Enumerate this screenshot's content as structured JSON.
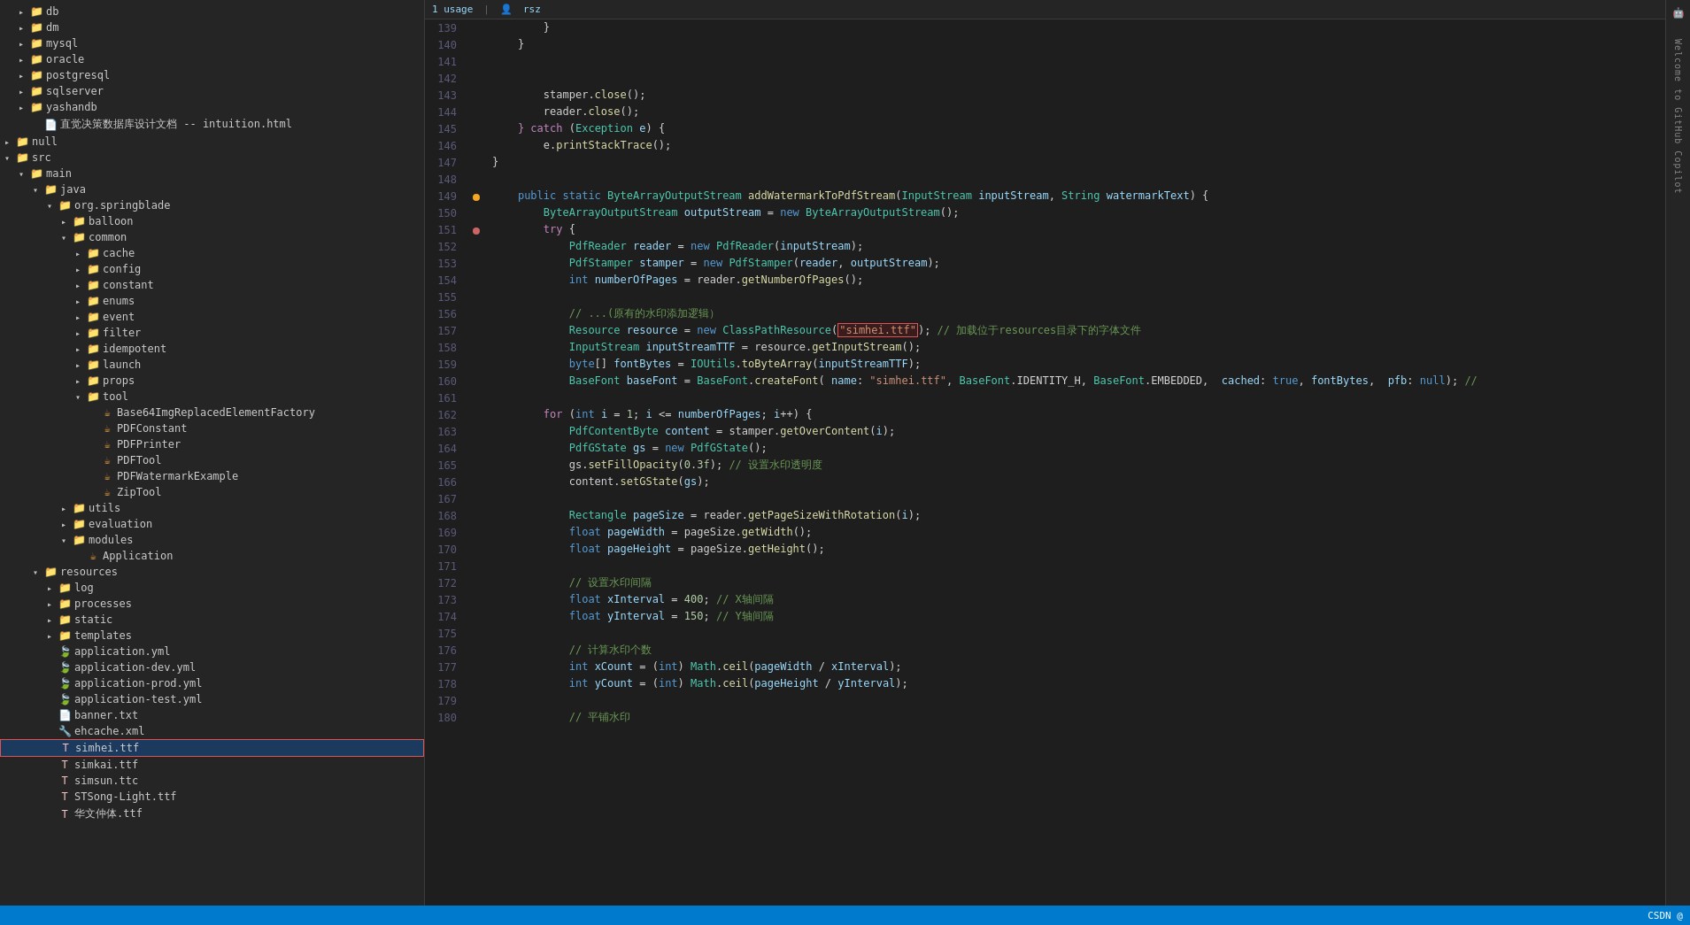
{
  "sidebar": {
    "items": [
      {
        "id": "db",
        "label": "db",
        "type": "folder",
        "indent": 1,
        "expanded": false
      },
      {
        "id": "dm",
        "label": "dm",
        "type": "folder",
        "indent": 1,
        "expanded": false
      },
      {
        "id": "mysql",
        "label": "mysql",
        "type": "folder",
        "indent": 1,
        "expanded": false
      },
      {
        "id": "oracle",
        "label": "oracle",
        "type": "folder",
        "indent": 1,
        "expanded": false
      },
      {
        "id": "postgresql",
        "label": "postgresql",
        "type": "folder",
        "indent": 1,
        "expanded": false
      },
      {
        "id": "sqlserver",
        "label": "sqlserver",
        "type": "folder",
        "indent": 1,
        "expanded": false
      },
      {
        "id": "yashandb",
        "label": "yashandb",
        "type": "folder",
        "indent": 1,
        "expanded": false
      },
      {
        "id": "intuition",
        "label": "直觉决策数据库设计文档 -- intuition.html",
        "type": "file",
        "indent": 2,
        "expanded": false
      },
      {
        "id": "null",
        "label": "null",
        "type": "folder",
        "indent": 0,
        "expanded": false
      },
      {
        "id": "src",
        "label": "src",
        "type": "folder",
        "indent": 0,
        "expanded": true
      },
      {
        "id": "main",
        "label": "main",
        "type": "folder",
        "indent": 1,
        "expanded": true
      },
      {
        "id": "java",
        "label": "java",
        "type": "folder",
        "indent": 2,
        "expanded": true
      },
      {
        "id": "org.springblade",
        "label": "org.springblade",
        "type": "folder",
        "indent": 3,
        "expanded": true
      },
      {
        "id": "balloon",
        "label": "balloon",
        "type": "folder",
        "indent": 4,
        "expanded": false
      },
      {
        "id": "common",
        "label": "common",
        "type": "folder",
        "indent": 4,
        "expanded": true
      },
      {
        "id": "cache",
        "label": "cache",
        "type": "folder",
        "indent": 5,
        "expanded": false
      },
      {
        "id": "config",
        "label": "config",
        "type": "folder",
        "indent": 5,
        "expanded": false
      },
      {
        "id": "constant",
        "label": "constant",
        "type": "folder",
        "indent": 5,
        "expanded": false
      },
      {
        "id": "enums",
        "label": "enums",
        "type": "folder",
        "indent": 5,
        "expanded": false
      },
      {
        "id": "event",
        "label": "event",
        "type": "folder",
        "indent": 5,
        "expanded": false
      },
      {
        "id": "filter",
        "label": "filter",
        "type": "folder",
        "indent": 5,
        "expanded": false
      },
      {
        "id": "idempotent",
        "label": "idempotent",
        "type": "folder",
        "indent": 5,
        "expanded": false
      },
      {
        "id": "launch",
        "label": "launch",
        "type": "folder",
        "indent": 5,
        "expanded": false
      },
      {
        "id": "props",
        "label": "props",
        "type": "folder",
        "indent": 5,
        "expanded": false
      },
      {
        "id": "tool",
        "label": "tool",
        "type": "folder",
        "indent": 5,
        "expanded": true
      },
      {
        "id": "Base64ImgReplacedElementFactory",
        "label": "Base64ImgReplacedElementFactory",
        "type": "java",
        "indent": 6,
        "expanded": false
      },
      {
        "id": "PDFConstant",
        "label": "PDFConstant",
        "type": "java",
        "indent": 6,
        "expanded": false
      },
      {
        "id": "PDFPrinter",
        "label": "PDFPrinter",
        "type": "java",
        "indent": 6,
        "expanded": false
      },
      {
        "id": "PDFTool",
        "label": "PDFTool",
        "type": "java",
        "indent": 6,
        "expanded": false
      },
      {
        "id": "PDFWatermarkExample",
        "label": "PDFWatermarkExample",
        "type": "java",
        "indent": 6,
        "expanded": false
      },
      {
        "id": "ZipTool",
        "label": "ZipTool",
        "type": "java",
        "indent": 6,
        "expanded": false
      },
      {
        "id": "utils",
        "label": "utils",
        "type": "folder",
        "indent": 4,
        "expanded": false
      },
      {
        "id": "evaluation",
        "label": "evaluation",
        "type": "folder",
        "indent": 4,
        "expanded": false
      },
      {
        "id": "modules",
        "label": "modules",
        "type": "folder",
        "indent": 4,
        "expanded": true
      },
      {
        "id": "Application",
        "label": "Application",
        "type": "java",
        "indent": 5,
        "expanded": false
      },
      {
        "id": "resources",
        "label": "resources",
        "type": "folder",
        "indent": 2,
        "expanded": true
      },
      {
        "id": "log",
        "label": "log",
        "type": "folder",
        "indent": 3,
        "expanded": false
      },
      {
        "id": "processes",
        "label": "processes",
        "type": "folder",
        "indent": 3,
        "expanded": false
      },
      {
        "id": "static",
        "label": "static",
        "type": "folder",
        "indent": 3,
        "expanded": false
      },
      {
        "id": "templates",
        "label": "templates",
        "type": "folder",
        "indent": 3,
        "expanded": false
      },
      {
        "id": "application.yml",
        "label": "application.yml",
        "type": "yaml",
        "indent": 3,
        "expanded": false
      },
      {
        "id": "application-dev.yml",
        "label": "application-dev.yml",
        "type": "yaml",
        "indent": 3,
        "expanded": false
      },
      {
        "id": "application-prod.yml",
        "label": "application-prod.yml",
        "type": "yaml",
        "indent": 3,
        "expanded": false
      },
      {
        "id": "application-test.yml",
        "label": "application-test.yml",
        "type": "yaml",
        "indent": 3,
        "expanded": false
      },
      {
        "id": "banner.txt",
        "label": "banner.txt",
        "type": "txt",
        "indent": 3,
        "expanded": false
      },
      {
        "id": "ehcache.xml",
        "label": "ehcache.xml",
        "type": "xml",
        "indent": 3,
        "expanded": false
      },
      {
        "id": "simhei.ttf",
        "label": "simhei.ttf",
        "type": "ttf",
        "indent": 3,
        "expanded": false,
        "selected": true
      },
      {
        "id": "simkai.ttf",
        "label": "simkai.ttf",
        "type": "ttf",
        "indent": 3,
        "expanded": false
      },
      {
        "id": "simsun.ttc",
        "label": "simsun.ttc",
        "type": "ttf",
        "indent": 3,
        "expanded": false
      },
      {
        "id": "STSong-Light.ttf",
        "label": "STSong-Light.ttf",
        "type": "ttf",
        "indent": 3,
        "expanded": false
      },
      {
        "id": "huawenzhongti.ttf",
        "label": "华文仲体.ttf",
        "type": "ttf",
        "indent": 3,
        "expanded": false
      }
    ]
  },
  "usage_bar": {
    "usages": "1 usage",
    "author": "rsz"
  },
  "code_lines": [
    {
      "num": 139,
      "content": "        }",
      "gutter": ""
    },
    {
      "num": 140,
      "content": "    }",
      "gutter": ""
    },
    {
      "num": 141,
      "content": "",
      "gutter": ""
    },
    {
      "num": 142,
      "content": "",
      "gutter": ""
    },
    {
      "num": 143,
      "content": "    stamper.close();",
      "gutter": ""
    },
    {
      "num": 144,
      "content": "    reader.close();",
      "gutter": ""
    },
    {
      "num": 145,
      "content": "} catch (Exception e) {",
      "gutter": ""
    },
    {
      "num": 146,
      "content": "    e.printStackTrace();",
      "gutter": ""
    },
    {
      "num": 147,
      "content": "}",
      "gutter": ""
    },
    {
      "num": 148,
      "content": "",
      "gutter": ""
    },
    {
      "num": 149,
      "content": "public static ByteArrayOutputStream addWatermarkToPdfStream(InputStream inputStream, String watermarkText) {",
      "gutter": "active"
    },
    {
      "num": 150,
      "content": "    ByteArrayOutputStream outputStream = new ByteArrayOutputStream();",
      "gutter": ""
    },
    {
      "num": 151,
      "content": "    try {",
      "gutter": "bp"
    },
    {
      "num": 152,
      "content": "        PdfReader reader = new PdfReader(inputStream);",
      "gutter": ""
    },
    {
      "num": 153,
      "content": "        PdfStamper stamper = new PdfStamper(reader, outputStream);",
      "gutter": ""
    },
    {
      "num": 154,
      "content": "        int numberOfPages = reader.getNumberOfPages();",
      "gutter": ""
    },
    {
      "num": 155,
      "content": "",
      "gutter": ""
    },
    {
      "num": 156,
      "content": "        // ...(原有的水印添加逻辑）",
      "gutter": ""
    },
    {
      "num": 157,
      "content": "        Resource resource = new ClassPathResource(\"simhei.ttf\"); // 加载位于resources目录下的字体文件",
      "gutter": ""
    },
    {
      "num": 158,
      "content": "        InputStream inputStreamTTF = resource.getInputStream();",
      "gutter": ""
    },
    {
      "num": 159,
      "content": "        byte[] fontBytes = IOUtils.toByteArray(inputStreamTTF);",
      "gutter": ""
    },
    {
      "num": 160,
      "content": "        BaseFont baseFont = BaseFont.createFont( name: \"simhei.ttf\", BaseFont.IDENTITY_H, BaseFont.EMBEDDED,  cached: true, fontBytes,  pfb: null); //",
      "gutter": ""
    },
    {
      "num": 161,
      "content": "",
      "gutter": ""
    },
    {
      "num": 162,
      "content": "        for (int i = 1; i <= numberOfPages; i++) {",
      "gutter": ""
    },
    {
      "num": 163,
      "content": "            PdfContentByte content = stamper.getOverContent(i);",
      "gutter": ""
    },
    {
      "num": 164,
      "content": "            PdfGState gs = new PdfGState();",
      "gutter": ""
    },
    {
      "num": 165,
      "content": "            gs.setFillOpacity(0.3f); // 设置水印透明度",
      "gutter": ""
    },
    {
      "num": 166,
      "content": "            content.setGState(gs);",
      "gutter": ""
    },
    {
      "num": 167,
      "content": "",
      "gutter": ""
    },
    {
      "num": 168,
      "content": "            Rectangle pageSize = reader.getPageSizeWithRotation(i);",
      "gutter": ""
    },
    {
      "num": 169,
      "content": "            float pageWidth = pageSize.getWidth();",
      "gutter": ""
    },
    {
      "num": 170,
      "content": "            float pageHeight = pageSize.getHeight();",
      "gutter": ""
    },
    {
      "num": 171,
      "content": "",
      "gutter": ""
    },
    {
      "num": 172,
      "content": "            // 设置水印间隔",
      "gutter": ""
    },
    {
      "num": 173,
      "content": "            float xInterval = 400; // X轴间隔",
      "gutter": ""
    },
    {
      "num": 174,
      "content": "            float yInterval = 150; // Y轴间隔",
      "gutter": ""
    },
    {
      "num": 175,
      "content": "",
      "gutter": ""
    },
    {
      "num": 176,
      "content": "            // 计算水印个数",
      "gutter": ""
    },
    {
      "num": 177,
      "content": "            int xCount = (int) Math.ceil(pageWidth / xInterval);",
      "gutter": ""
    },
    {
      "num": 178,
      "content": "            int yCount = (int) Math.ceil(pageHeight / yInterval);",
      "gutter": ""
    },
    {
      "num": 179,
      "content": "",
      "gutter": ""
    },
    {
      "num": 180,
      "content": "            // 平铺水印",
      "gutter": ""
    }
  ],
  "status_bar": {
    "right_text": "CSDN @"
  }
}
